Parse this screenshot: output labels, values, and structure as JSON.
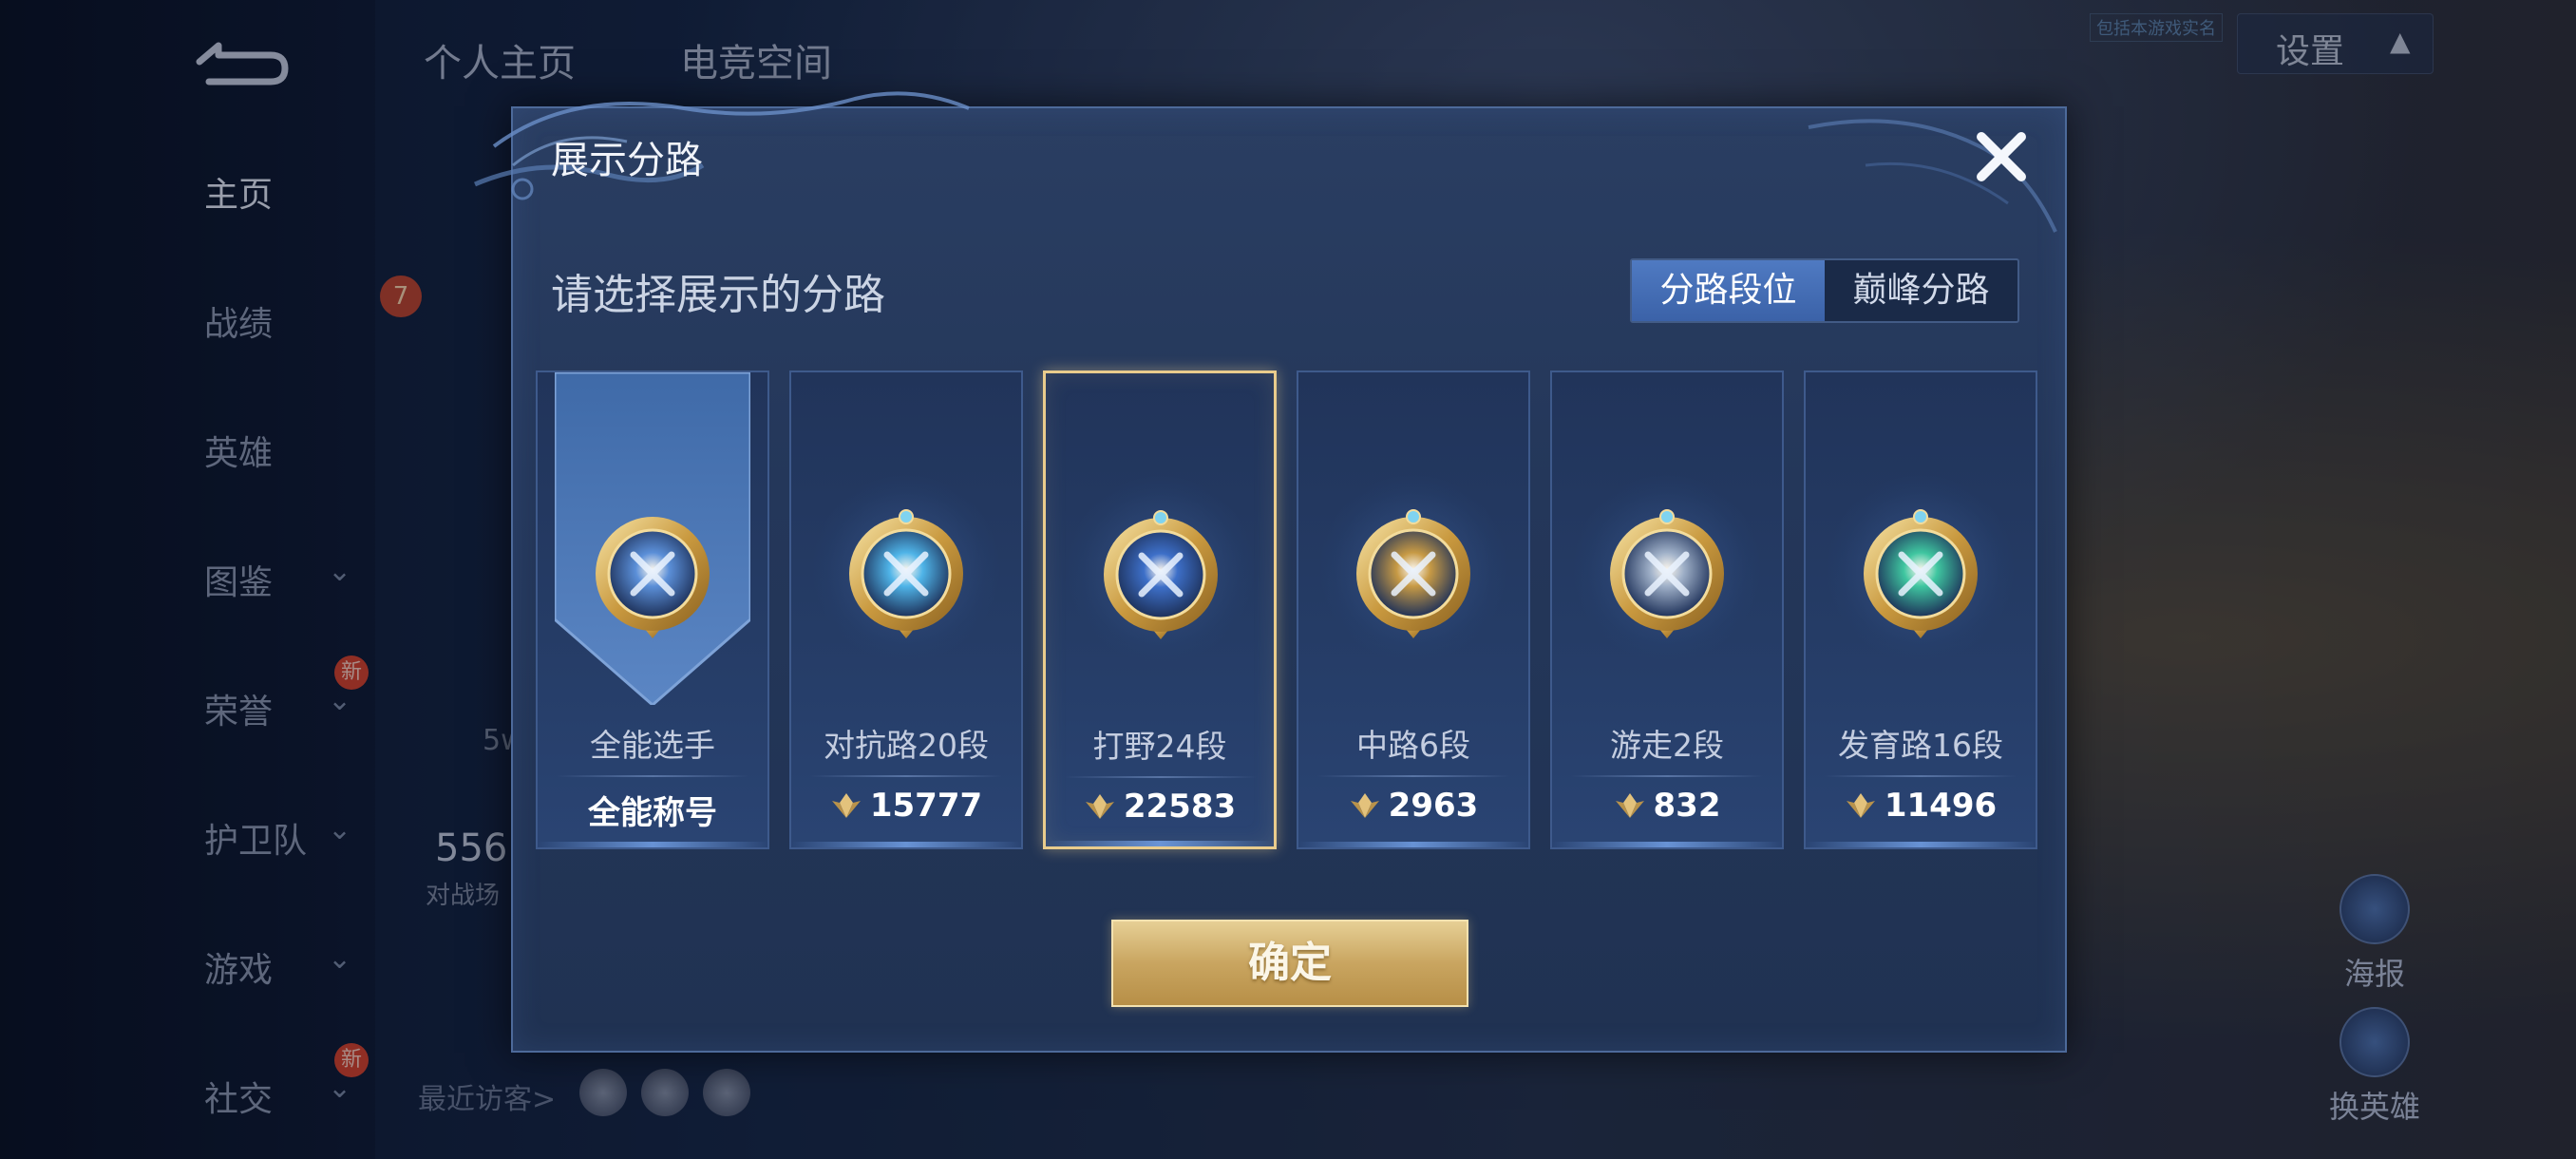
{
  "top_tabs": [
    "个人主页",
    "电竞空间"
  ],
  "top_notice": "包括本游戏实名",
  "settings": {
    "label": "设置"
  },
  "sidebar": {
    "items": [
      {
        "label": "主页",
        "active": true,
        "chevron": false,
        "badge": ""
      },
      {
        "label": "战绩",
        "active": false,
        "chevron": false,
        "badge": ""
      },
      {
        "label": "英雄",
        "active": false,
        "chevron": false,
        "badge": ""
      },
      {
        "label": "图鉴",
        "active": false,
        "chevron": true,
        "badge": ""
      },
      {
        "label": "荣誉",
        "active": false,
        "chevron": true,
        "badge": "新"
      },
      {
        "label": "护卫队",
        "active": false,
        "chevron": true,
        "badge": ""
      },
      {
        "label": "游戏",
        "active": false,
        "chevron": true,
        "badge": ""
      },
      {
        "label": "社交",
        "active": false,
        "chevron": true,
        "badge": "新"
      }
    ]
  },
  "background": {
    "level_badge": "7",
    "stat_5w": "5w",
    "stat_number": "556",
    "stat_sub": "对战场",
    "recent_visitors": "最近访客>",
    "right_actions": [
      "海报",
      "换英雄"
    ]
  },
  "modal": {
    "title": "展示分路",
    "subtitle": "请选择展示的分路",
    "close_icon": "close-x-icon",
    "tabs": [
      {
        "label": "分路段位",
        "active": true
      },
      {
        "label": "巅峰分路",
        "active": false
      }
    ],
    "cards": [
      {
        "name": "全能选手",
        "score": "全能称号",
        "show_gem": false,
        "selected": false,
        "emblem": "all-round-emblem-icon",
        "color": "#5b8fd8"
      },
      {
        "name": "对抗路20段",
        "score": "15777",
        "show_gem": true,
        "selected": false,
        "emblem": "clash-lane-emblem-icon",
        "color": "#4fb4e8"
      },
      {
        "name": "打野24段",
        "score": "22583",
        "show_gem": true,
        "selected": true,
        "emblem": "jungle-emblem-icon",
        "color": "#3d6fc8"
      },
      {
        "name": "中路6段",
        "score": "2963",
        "show_gem": true,
        "selected": false,
        "emblem": "mid-lane-emblem-icon",
        "color": "#c79a45"
      },
      {
        "name": "游走2段",
        "score": "832",
        "show_gem": true,
        "selected": false,
        "emblem": "roam-emblem-icon",
        "color": "#9fb0c8"
      },
      {
        "name": "发育路16段",
        "score": "11496",
        "show_gem": true,
        "selected": false,
        "emblem": "farm-lane-emblem-icon",
        "color": "#3fc6a0"
      }
    ],
    "confirm_label": "确定"
  },
  "colors": {
    "gold": "#e9cc8c",
    "panel": "#24375a",
    "accent_blue": "#4f7ac2"
  }
}
